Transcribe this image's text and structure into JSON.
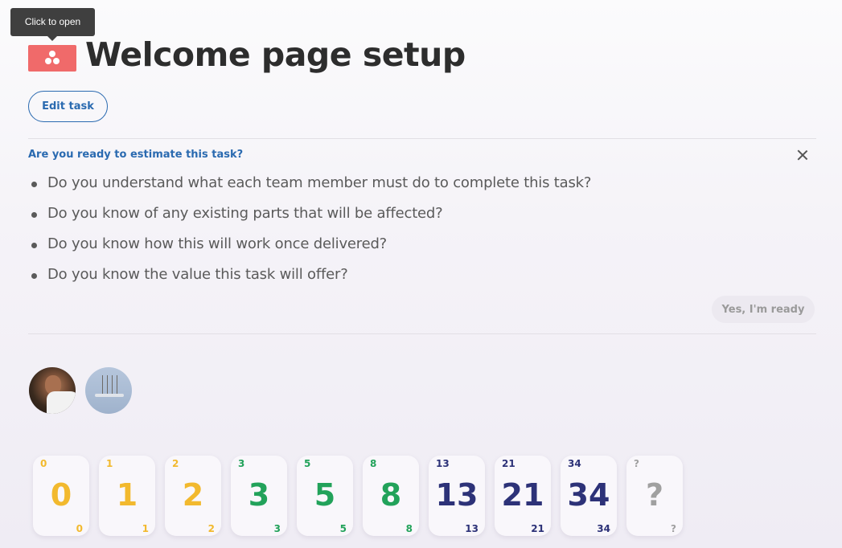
{
  "tooltip": "Click to open",
  "header": {
    "title": "Welcome page setup",
    "edit_button": "Edit task",
    "icon": "asana-dots-icon"
  },
  "readiness": {
    "title": "Are you ready to estimate this task?",
    "questions": [
      "Do you understand what each team member must do to complete this task?",
      "Do you know of any existing parts that will be affected?",
      "Do you know how this will work once delivered?",
      "Do you know the value this task will offer?"
    ],
    "ready_button": "Yes, I'm ready"
  },
  "participants": [
    {
      "name": "user-photo-avatar"
    },
    {
      "name": "sailing-ship-avatar"
    }
  ],
  "colors": {
    "accent": "#2a6ab0",
    "task_icon": "#f06a6a",
    "yellow": "#f2b92e",
    "green": "#22a25a",
    "navy": "#2d3278",
    "gray": "#a0a0a0"
  },
  "cards": [
    {
      "value": "0",
      "color": "#f2b92e"
    },
    {
      "value": "1",
      "color": "#f2b92e"
    },
    {
      "value": "2",
      "color": "#f2b92e"
    },
    {
      "value": "3",
      "color": "#22a25a"
    },
    {
      "value": "5",
      "color": "#22a25a"
    },
    {
      "value": "8",
      "color": "#22a25a"
    },
    {
      "value": "13",
      "color": "#2d3278"
    },
    {
      "value": "21",
      "color": "#2d3278"
    },
    {
      "value": "34",
      "color": "#2d3278"
    },
    {
      "value": "?",
      "color": "#a0a0a0"
    }
  ]
}
